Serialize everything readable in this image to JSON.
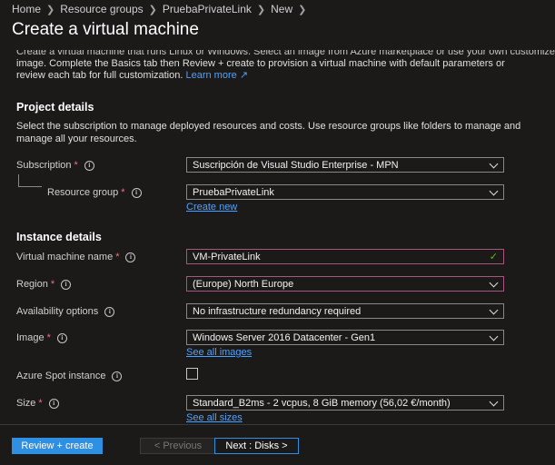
{
  "breadcrumb": [
    "Home",
    "Resource groups",
    "PruebaPrivateLink",
    "New"
  ],
  "page_title": "Create a virtual machine",
  "intro": {
    "clipped_line": "Create a virtual machine that runs Linux or Windows. Select an image from Azure marketplace or use your own customized",
    "text": "image. Complete the Basics tab then Review + create to provision a virtual machine with default parameters or review each tab for full customization.",
    "link": "Learn more"
  },
  "project_details": {
    "title": "Project details",
    "description": "Select the subscription to manage deployed resources and costs. Use resource groups like folders to manage and manage all your resources.",
    "subscription": {
      "label": "Subscription",
      "value": "Suscripción de Visual Studio Enterprise - MPN"
    },
    "resource_group": {
      "label": "Resource group",
      "value": "PruebaPrivateLink",
      "create_new": "Create new"
    }
  },
  "instance_details": {
    "title": "Instance details",
    "vm_name": {
      "label": "Virtual machine name",
      "value": "VM-PrivateLink"
    },
    "region": {
      "label": "Region",
      "value": "(Europe) North Europe"
    },
    "availability": {
      "label": "Availability options",
      "value": "No infrastructure redundancy required"
    },
    "image": {
      "label": "Image",
      "value": "Windows Server 2016 Datacenter - Gen1",
      "see_all": "See all images"
    },
    "spot": {
      "label": "Azure Spot instance"
    },
    "size": {
      "label": "Size",
      "value": "Standard_B2ms - 2 vcpus, 8 GiB memory (56,02 €/month)",
      "see_all": "See all sizes"
    }
  },
  "footer": {
    "review_create": "Review + create",
    "previous": "< Previous",
    "next": "Next : Disks >"
  },
  "colors": {
    "accent": "#2f8fe3",
    "required": "#f1707b",
    "valid": "#6bb700",
    "highlight_border": "#a8567f"
  }
}
